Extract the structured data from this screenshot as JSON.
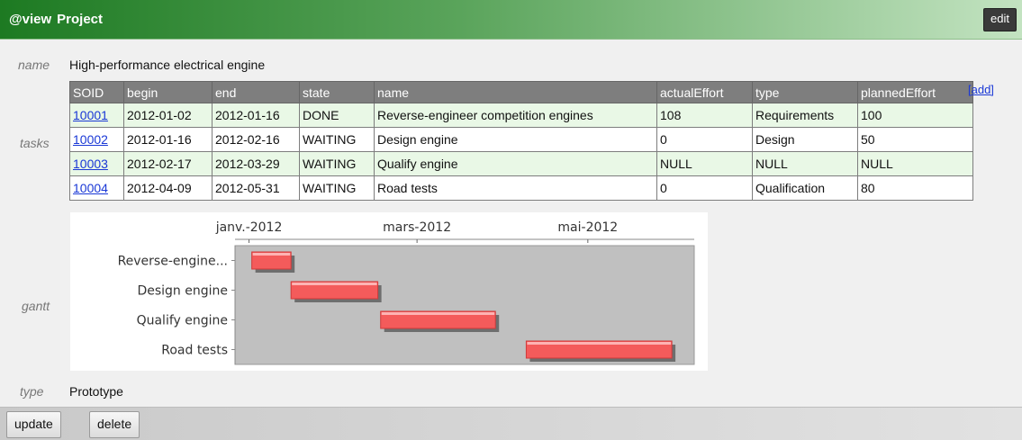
{
  "header": {
    "prefix": "@view",
    "title": "Project",
    "edit_label": "edit"
  },
  "fields": {
    "name_label": "name",
    "name_value": "High-performance electrical engine",
    "tasks_label": "tasks",
    "gantt_label": "gantt",
    "type_label": "type",
    "type_value": "Prototype"
  },
  "tasks": {
    "add_label": "[add]",
    "columns": [
      "SOID",
      "begin",
      "end",
      "state",
      "name",
      "actualEffort",
      "type",
      "plannedEffort"
    ],
    "rows": [
      [
        "10001",
        "2012-01-02",
        "2012-01-16",
        "DONE",
        "Reverse-engineer competition engines",
        "108",
        "Requirements",
        "100"
      ],
      [
        "10002",
        "2012-01-16",
        "2012-02-16",
        "WAITING",
        "Design engine",
        "0",
        "Design",
        "50"
      ],
      [
        "10003",
        "2012-02-17",
        "2012-03-29",
        "WAITING",
        "Qualify engine",
        "NULL",
        "NULL",
        "NULL"
      ],
      [
        "10004",
        "2012-04-09",
        "2012-05-31",
        "WAITING",
        "Road tests",
        "0",
        "Qualification",
        "80"
      ]
    ]
  },
  "gantt": {
    "axis_start": "2011-12-27",
    "axis_end": "2012-06-08",
    "ticks": [
      {
        "label": "janv.-2012",
        "date": "2012-01-01"
      },
      {
        "label": "mars-2012",
        "date": "2012-03-01"
      },
      {
        "label": "mai-2012",
        "date": "2012-05-01"
      }
    ],
    "tasks": [
      {
        "label": "Reverse-engine...",
        "start": "2012-01-02",
        "end": "2012-01-16"
      },
      {
        "label": "Design engine",
        "start": "2012-01-16",
        "end": "2012-02-16"
      },
      {
        "label": "Qualify engine",
        "start": "2012-02-17",
        "end": "2012-03-29"
      },
      {
        "label": "Road tests",
        "start": "2012-04-09",
        "end": "2012-05-31"
      }
    ],
    "bar_color": "#f45b5b",
    "plot_bg": "#c0c0c0"
  },
  "footer": {
    "update_label": "update",
    "delete_label": "delete"
  }
}
